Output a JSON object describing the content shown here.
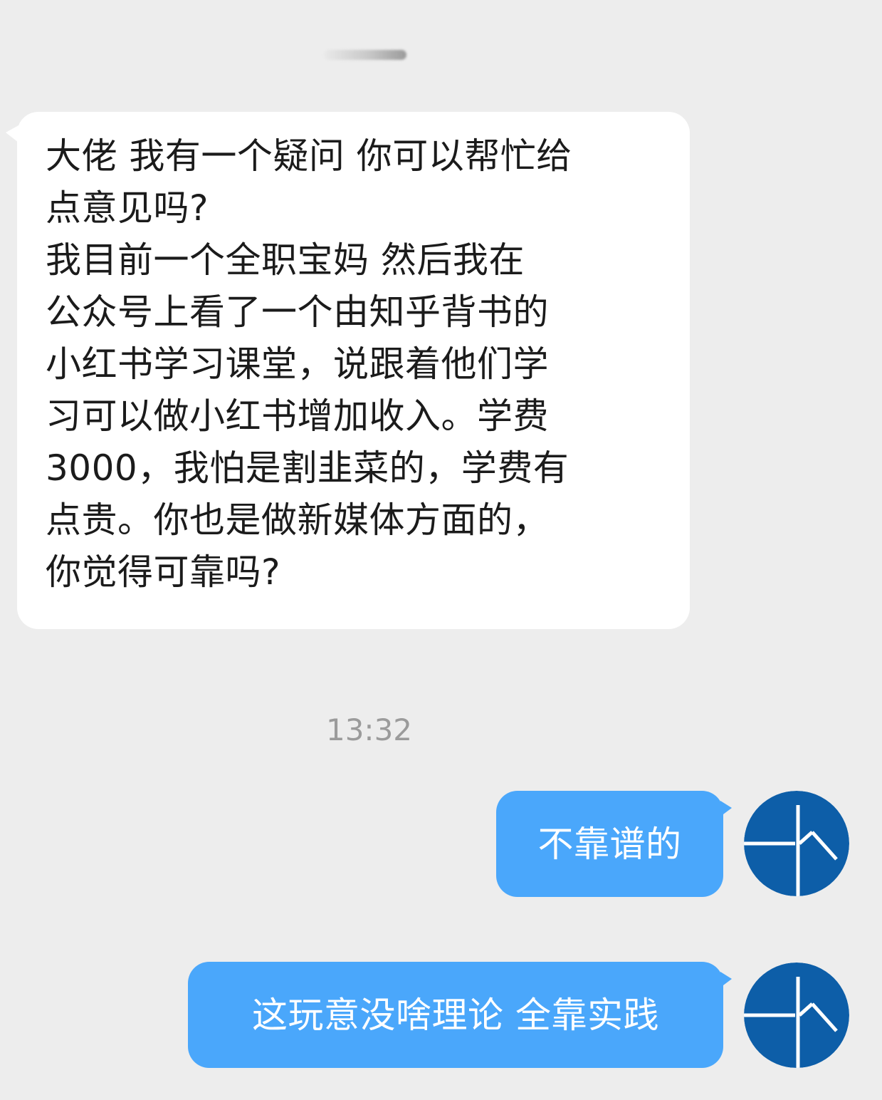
{
  "header": {
    "blurred_name": ""
  },
  "messages": {
    "incoming": {
      "lines": [
        "大佬 我有一个疑问 你可以帮忙给",
        "点意见吗?",
        "我目前一个全职宝妈 然后我在",
        "公众号上看了一个由知乎背书的",
        "小红书学习课堂，说跟着他们学",
        "习可以做小红书增加收入。学费",
        "3000，我怕是割韭菜的，学费有",
        "点贵。你也是做新媒体方面的，",
        "你觉得可靠吗?"
      ]
    },
    "timestamp": "13:32",
    "outgoing": [
      {
        "text": "不靠谱的"
      },
      {
        "text": "这玩意没啥理论 全靠实践"
      }
    ]
  },
  "colors": {
    "background": "#ededed",
    "incoming_bubble": "#ffffff",
    "outgoing_bubble": "#4aa7fb",
    "avatar_blue": "#0d5ea8",
    "timestamp_text": "#9b9b9b"
  },
  "icons": {
    "avatar": "blue-circle-logo-icon"
  }
}
